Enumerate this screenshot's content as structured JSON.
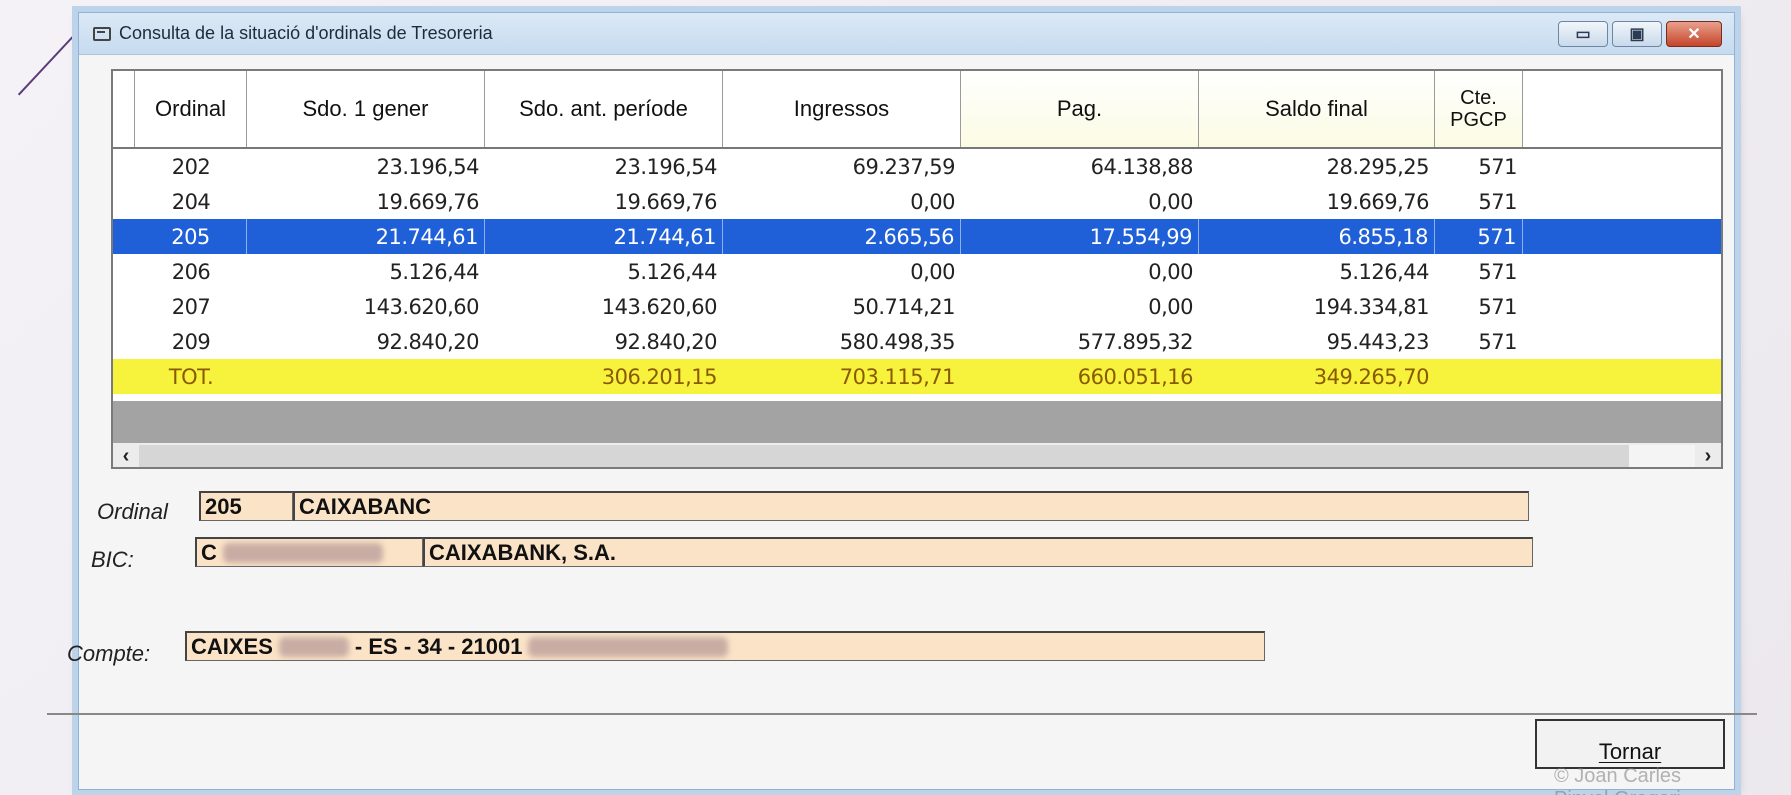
{
  "window": {
    "title": "Consulta de la situació d'ordinals de Tresoreria",
    "icon": "window-app-icon",
    "controls": {
      "minimize": "▭",
      "maximize": "▣",
      "close": "✕"
    }
  },
  "grid": {
    "columns": [
      "Ordinal",
      "Sdo. 1 gener",
      "Sdo. ant. període",
      "Ingressos",
      "Pag.",
      "Saldo final",
      "Cte. PGCP"
    ],
    "rows": [
      {
        "ordinal": "202",
        "sdo_gener": "23.196,54",
        "sdo_ant": "23.196,54",
        "ingressos": "69.237,59",
        "pag": "64.138,88",
        "saldo_final": "28.295,25",
        "cte": "571"
      },
      {
        "ordinal": "204",
        "sdo_gener": "19.669,76",
        "sdo_ant": "19.669,76",
        "ingressos": "0,00",
        "pag": "0,00",
        "saldo_final": "19.669,76",
        "cte": "571"
      },
      {
        "ordinal": "205",
        "sdo_gener": "21.744,61",
        "sdo_ant": "21.744,61",
        "ingressos": "2.665,56",
        "pag": "17.554,99",
        "saldo_final": "6.855,18",
        "cte": "571",
        "selected": true
      },
      {
        "ordinal": "206",
        "sdo_gener": "5.126,44",
        "sdo_ant": "5.126,44",
        "ingressos": "0,00",
        "pag": "0,00",
        "saldo_final": "5.126,44",
        "cte": "571"
      },
      {
        "ordinal": "207",
        "sdo_gener": "143.620,60",
        "sdo_ant": "143.620,60",
        "ingressos": "50.714,21",
        "pag": "0,00",
        "saldo_final": "194.334,81",
        "cte": "571"
      },
      {
        "ordinal": "209",
        "sdo_gener": "92.840,20",
        "sdo_ant": "92.840,20",
        "ingressos": "580.498,35",
        "pag": "577.895,32",
        "saldo_final": "95.443,23",
        "cte": "571"
      }
    ],
    "total": {
      "ordinal": "TOT.",
      "sdo_gener": "",
      "sdo_ant": "306.201,15",
      "ingressos": "703.115,71",
      "pag": "660.051,16",
      "saldo_final": "349.265,70",
      "cte": ""
    },
    "scroll": {
      "left": "‹",
      "right": "›"
    }
  },
  "form": {
    "ordinal_label": "Ordinal",
    "ordinal_code": "205",
    "ordinal_name": "CAIXABANC",
    "bic_label": "BIC:",
    "bic_code": "C",
    "bic_name": "CAIXABANK, S.A.",
    "compte_label": "Compte:",
    "compte_part1": "CAIXES",
    "compte_part2": "- ES - 34 - 21001"
  },
  "buttons": {
    "tornar": "Tornar"
  },
  "watermark": "© Joan Carles Pinyol Gregori",
  "colors": {
    "selection": "#1f5fd8",
    "total_row": "#f7f23c",
    "field_bg": "#fbe3c7"
  }
}
